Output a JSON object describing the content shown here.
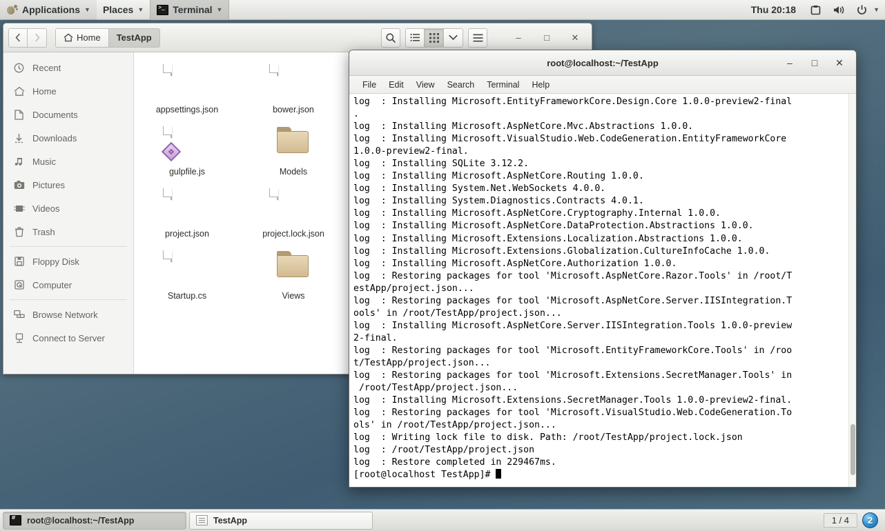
{
  "top_panel": {
    "applications_label": "Applications",
    "places_label": "Places",
    "active_app_label": "Terminal",
    "clock": "Thu 20:18",
    "tray": [
      "screenshot-icon",
      "volume-icon",
      "power-icon"
    ]
  },
  "file_manager": {
    "nav": {
      "back": "‹",
      "forward": "›"
    },
    "breadcrumb": [
      {
        "label": "Home",
        "icon": "home-icon",
        "current": false
      },
      {
        "label": "TestApp",
        "icon": "",
        "current": true
      }
    ],
    "toolbar": {
      "search": "search-icon",
      "list_view": "list-view-icon",
      "grid_view": "grid-view-icon",
      "view_options": "chevron-down-icon",
      "menu": "hamburger-menu-icon"
    },
    "window_controls": {
      "minimize": "–",
      "maximize": "□",
      "close": "✕"
    },
    "sidebar": {
      "groups": [
        [
          {
            "label": "Recent",
            "icon": "clock-icon"
          },
          {
            "label": "Home",
            "icon": "home-icon"
          },
          {
            "label": "Documents",
            "icon": "document-icon"
          },
          {
            "label": "Downloads",
            "icon": "download-icon"
          },
          {
            "label": "Music",
            "icon": "music-icon"
          },
          {
            "label": "Pictures",
            "icon": "camera-icon"
          },
          {
            "label": "Videos",
            "icon": "video-icon"
          },
          {
            "label": "Trash",
            "icon": "trash-icon"
          }
        ],
        [
          {
            "label": "Floppy Disk",
            "icon": "floppy-icon"
          },
          {
            "label": "Computer",
            "icon": "computer-icon"
          }
        ],
        [
          {
            "label": "Browse Network",
            "icon": "network-icon"
          },
          {
            "label": "Connect to Server",
            "icon": "server-icon"
          }
        ]
      ]
    },
    "files": [
      {
        "name": "appsettings.json",
        "type": "document"
      },
      {
        "name": "bower.json",
        "type": "document"
      },
      {
        "name": "gulpfile.js",
        "type": "javascript"
      },
      {
        "name": "Models",
        "type": "folder"
      },
      {
        "name": "project.json",
        "type": "document"
      },
      {
        "name": "project.lock.json",
        "type": "document"
      },
      {
        "name": "Startup.cs",
        "type": "document"
      },
      {
        "name": "Views",
        "type": "folder"
      }
    ]
  },
  "terminal": {
    "title": "root@localhost:~/TestApp",
    "window_controls": {
      "minimize": "–",
      "maximize": "□",
      "close": "✕"
    },
    "menus": [
      "File",
      "Edit",
      "View",
      "Search",
      "Terminal",
      "Help"
    ],
    "output": "log  : Installing Microsoft.EntityFrameworkCore.Design.Core 1.0.0-preview2-final\n.\nlog  : Installing Microsoft.AspNetCore.Mvc.Abstractions 1.0.0.\nlog  : Installing Microsoft.VisualStudio.Web.CodeGeneration.EntityFrameworkCore\n1.0.0-preview2-final.\nlog  : Installing SQLite 3.12.2.\nlog  : Installing Microsoft.AspNetCore.Routing 1.0.0.\nlog  : Installing System.Net.WebSockets 4.0.0.\nlog  : Installing System.Diagnostics.Contracts 4.0.1.\nlog  : Installing Microsoft.AspNetCore.Cryptography.Internal 1.0.0.\nlog  : Installing Microsoft.AspNetCore.DataProtection.Abstractions 1.0.0.\nlog  : Installing Microsoft.Extensions.Localization.Abstractions 1.0.0.\nlog  : Installing Microsoft.Extensions.Globalization.CultureInfoCache 1.0.0.\nlog  : Installing Microsoft.AspNetCore.Authorization 1.0.0.\nlog  : Restoring packages for tool 'Microsoft.AspNetCore.Razor.Tools' in /root/T\nestApp/project.json...\nlog  : Restoring packages for tool 'Microsoft.AspNetCore.Server.IISIntegration.T\nools' in /root/TestApp/project.json...\nlog  : Installing Microsoft.AspNetCore.Server.IISIntegration.Tools 1.0.0-preview\n2-final.\nlog  : Restoring packages for tool 'Microsoft.EntityFrameworkCore.Tools' in /roo\nt/TestApp/project.json...\nlog  : Restoring packages for tool 'Microsoft.Extensions.SecretManager.Tools' in\n /root/TestApp/project.json...\nlog  : Installing Microsoft.Extensions.SecretManager.Tools 1.0.0-preview2-final.\nlog  : Restoring packages for tool 'Microsoft.VisualStudio.Web.CodeGeneration.To\nols' in /root/TestApp/project.json...\nlog  : Writing lock file to disk. Path: /root/TestApp/project.lock.json\nlog  : /root/TestApp/project.json\nlog  : Restore completed in 229467ms.\n",
    "prompt": "[root@localhost TestApp]# "
  },
  "bottom_panel": {
    "tasks": [
      {
        "label": "root@localhost:~/TestApp",
        "icon": "terminal-icon",
        "active": true
      },
      {
        "label": "TestApp",
        "icon": "files-icon",
        "active": false
      }
    ],
    "workspace": "1 / 4",
    "notification_count": "2"
  },
  "colors": {
    "desktop_top": "#4a6477",
    "desktop_bottom": "#4e6e80",
    "panel_bg": "#e8e8e6",
    "folder": "#d2bb92",
    "accent_badge": "#3d9bd6"
  }
}
